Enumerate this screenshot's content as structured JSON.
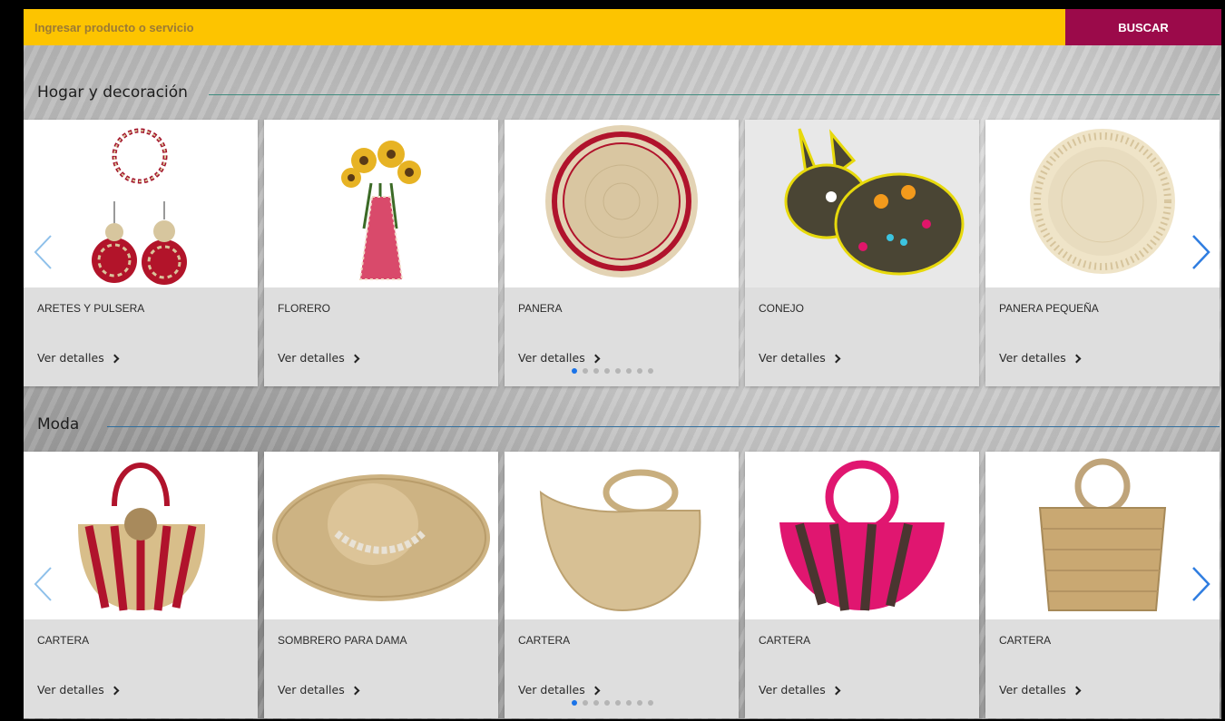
{
  "search": {
    "placeholder": "Ingresar producto o servicio",
    "button_label": "BUSCAR"
  },
  "colors": {
    "search_bg": "#fdc400",
    "button_bg": "#9b0a4a",
    "active_dot": "#1a73e8",
    "arrow": "#2f7de0"
  },
  "sections": [
    {
      "title": "Hogar y decoración",
      "products": [
        {
          "name": "ARETES Y PULSERA",
          "link": "Ver detalles",
          "icon": "earrings-bracelet-icon"
        },
        {
          "name": "FLORERO",
          "link": "Ver detalles",
          "icon": "vase-flowers-icon"
        },
        {
          "name": "PANERA",
          "link": "Ver detalles",
          "icon": "bread-basket-icon"
        },
        {
          "name": "CONEJO",
          "link": "Ver detalles",
          "icon": "rabbit-plush-icon"
        },
        {
          "name": "PANERA PEQUEÑA",
          "link": "Ver detalles",
          "icon": "small-basket-icon"
        }
      ],
      "dots": 8,
      "active_dot": 0
    },
    {
      "title": "Moda",
      "products": [
        {
          "name": "CARTERA",
          "link": "Ver detalles",
          "icon": "striped-handbag-icon"
        },
        {
          "name": "SOMBRERO PARA DAMA",
          "link": "Ver detalles",
          "icon": "wide-hat-icon"
        },
        {
          "name": "CARTERA",
          "link": "Ver detalles",
          "icon": "straw-handbag-icon"
        },
        {
          "name": "CARTERA",
          "link": "Ver detalles",
          "icon": "pink-handbag-icon"
        },
        {
          "name": "CARTERA",
          "link": "Ver detalles",
          "icon": "tote-basket-icon"
        }
      ],
      "dots": 8,
      "active_dot": 0
    }
  ]
}
